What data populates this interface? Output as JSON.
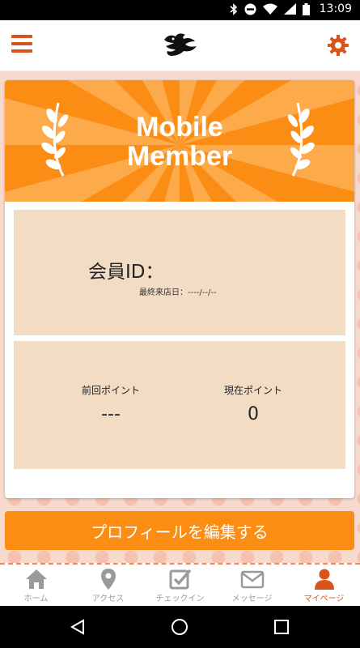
{
  "status_bar": {
    "time": "13:09",
    "icons": [
      "bluetooth-icon",
      "do-not-disturb-icon",
      "wifi-icon",
      "signal-icon",
      "battery-icon"
    ]
  },
  "header": {
    "menu_icon": "hamburger-menu-icon",
    "logo_icon": "dragon-logo-icon",
    "settings_icon": "gear-icon"
  },
  "member_card": {
    "banner_title_line1": "Mobile",
    "banner_title_line2": "Member",
    "member_id_label": "会員ID：",
    "member_id_value": "",
    "last_visit": "最終来店日：----/--/--",
    "previous_points_label": "前回ポイント",
    "previous_points_value": "---",
    "current_points_label": "現在ポイント",
    "current_points_value": "0"
  },
  "actions": {
    "edit_profile_label": "プロフィールを編集する"
  },
  "tabs": [
    {
      "label": "ホーム",
      "icon": "home-icon",
      "active": false
    },
    {
      "label": "アクセス",
      "icon": "map-pin-icon",
      "active": false
    },
    {
      "label": "チェックイン",
      "icon": "checkbox-icon",
      "active": false
    },
    {
      "label": "メッセージ",
      "icon": "envelope-icon",
      "active": false
    },
    {
      "label": "マイページ",
      "icon": "person-icon",
      "active": true
    }
  ],
  "colors": {
    "accent": "#d9541b",
    "banner_orange": "#fb8c14",
    "panel_beige": "#f3dcc4",
    "background_pink": "#f7d9cd",
    "inactive_tab": "#9a9a9a"
  }
}
